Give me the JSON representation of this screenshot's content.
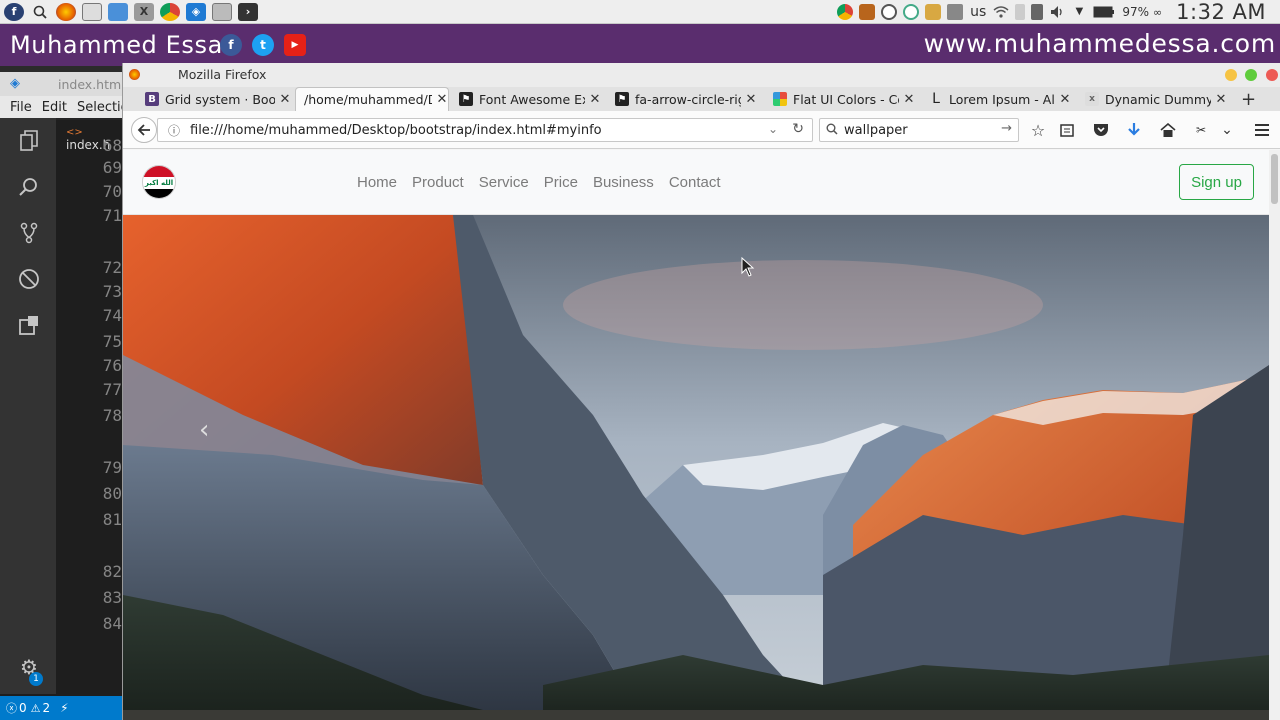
{
  "os_panel": {
    "keyboard_layout": "us",
    "battery": "97%",
    "battery_suffix": "∞",
    "clock": "1:32 AM"
  },
  "banner": {
    "name": "Muhammed Essa",
    "social": [
      "f",
      "t",
      "▶"
    ],
    "website": "www.muhammedessa.com"
  },
  "vscode": {
    "tab_title": "index.html",
    "editor_tab": "index.h",
    "menu": [
      "File",
      "Edit",
      "Selectio"
    ],
    "line_numbers": [
      "68",
      "69",
      "70",
      "71",
      "72",
      "73",
      "74",
      "75",
      "76",
      "77",
      "78",
      "79",
      "80",
      "81",
      "82",
      "83",
      "84"
    ],
    "status_errors": "0",
    "status_warnings": "2",
    "settings_badge": "1"
  },
  "firefox": {
    "title": "Mozilla Firefox",
    "tabs": [
      {
        "label": "Grid system · Boot",
        "icon": "bootstrap-icon"
      },
      {
        "label": "/home/muhammed/D",
        "icon": "none"
      },
      {
        "label": "Font Awesome Ex",
        "icon": "flag-icon"
      },
      {
        "label": "fa-arrow-circle-rigl",
        "icon": "flag-icon"
      },
      {
        "label": "Flat UI Colors - Col",
        "icon": "colors-icon"
      },
      {
        "label": "Lorem Ipsum - All",
        "icon": "lorem-icon"
      },
      {
        "label": "Dynamic Dummy",
        "icon": "dummy-icon"
      }
    ],
    "url": "file:///home/muhammed/Desktop/bootstrap/index.html#myinfo",
    "search": "wallpaper"
  },
  "site": {
    "logo_text": "الله اكبر",
    "menu": [
      "Home",
      "Product",
      "Service",
      "Price",
      "Business",
      "Contact"
    ],
    "signup": "Sign up"
  },
  "colors": {
    "banner": "#5a2d6e",
    "signup_green": "#28a745",
    "nav_link": "#7b7b7b"
  }
}
